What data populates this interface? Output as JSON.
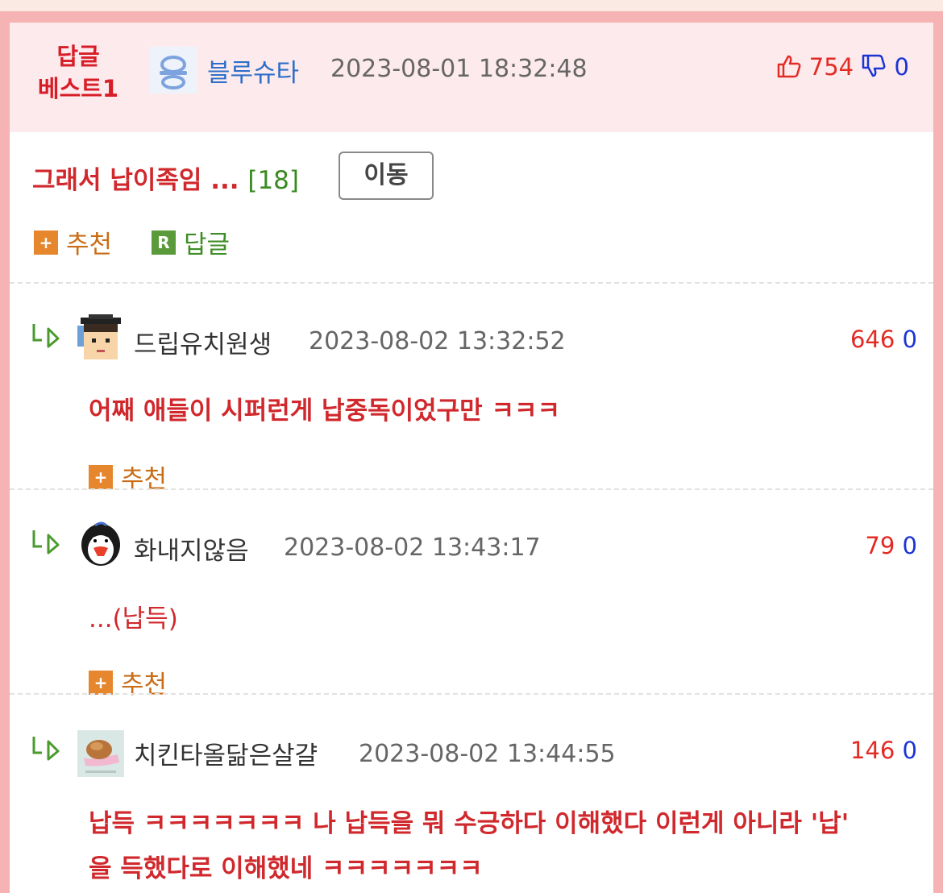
{
  "best_comment": {
    "label_line1": "답글",
    "label_line2": "베스트1",
    "avatar_icon": "blue-sugar-avatar-icon",
    "username": "블루슈타",
    "timestamp": "2023-08-01 18:32:48",
    "likes": "754",
    "dislikes": "0",
    "like_icon": "thumbs-up-icon",
    "dislike_icon": "thumbs-down-icon",
    "title": "그래서 납이족임 ...",
    "reply_count": "[18]",
    "move_label": "이동",
    "recommend_label": "추천",
    "reply_label": "답글",
    "recommend_icon_glyph": "+",
    "reply_icon_glyph": "R"
  },
  "replies": [
    {
      "username": "드립유치원생",
      "timestamp": "2023-08-02 13:32:52",
      "likes": "646",
      "dislikes": "0",
      "body": "어째 애들이 시퍼런게 납중독이었구만 ㅋㅋㅋ",
      "recommend_label": "추천",
      "avatar_icon": "kindergarten-avatar-icon"
    },
    {
      "username": "화내지않음",
      "timestamp": "2023-08-02 13:43:17",
      "likes": "79",
      "dislikes": "0",
      "body": "...(납득)",
      "recommend_label": "추천",
      "avatar_icon": "penguin-avatar-icon"
    },
    {
      "username": "치킨타올닮은살걀",
      "timestamp": "2023-08-02 13:44:55",
      "likes": "146",
      "dislikes": "0",
      "body_line1": "납득 ㅋㅋㅋㅋㅋㅋㅋ 나 납득을 뭐 수긍하다 이해했다 이런게 아니라 '납'",
      "body_line2": "을 득했다로 이해했네 ㅋㅋㅋㅋㅋㅋㅋ",
      "avatar_icon": "chicken-avatar-icon"
    }
  ],
  "colors": {
    "accent_red": "#d0282c",
    "link_blue": "#2d6fc9",
    "count_green": "#3a8a22",
    "recommend_orange": "#e6872d",
    "header_bg": "#fdeaec",
    "frame_pink": "#f6b3b3"
  },
  "reply_arrow_icon": "reply-arrow-icon"
}
